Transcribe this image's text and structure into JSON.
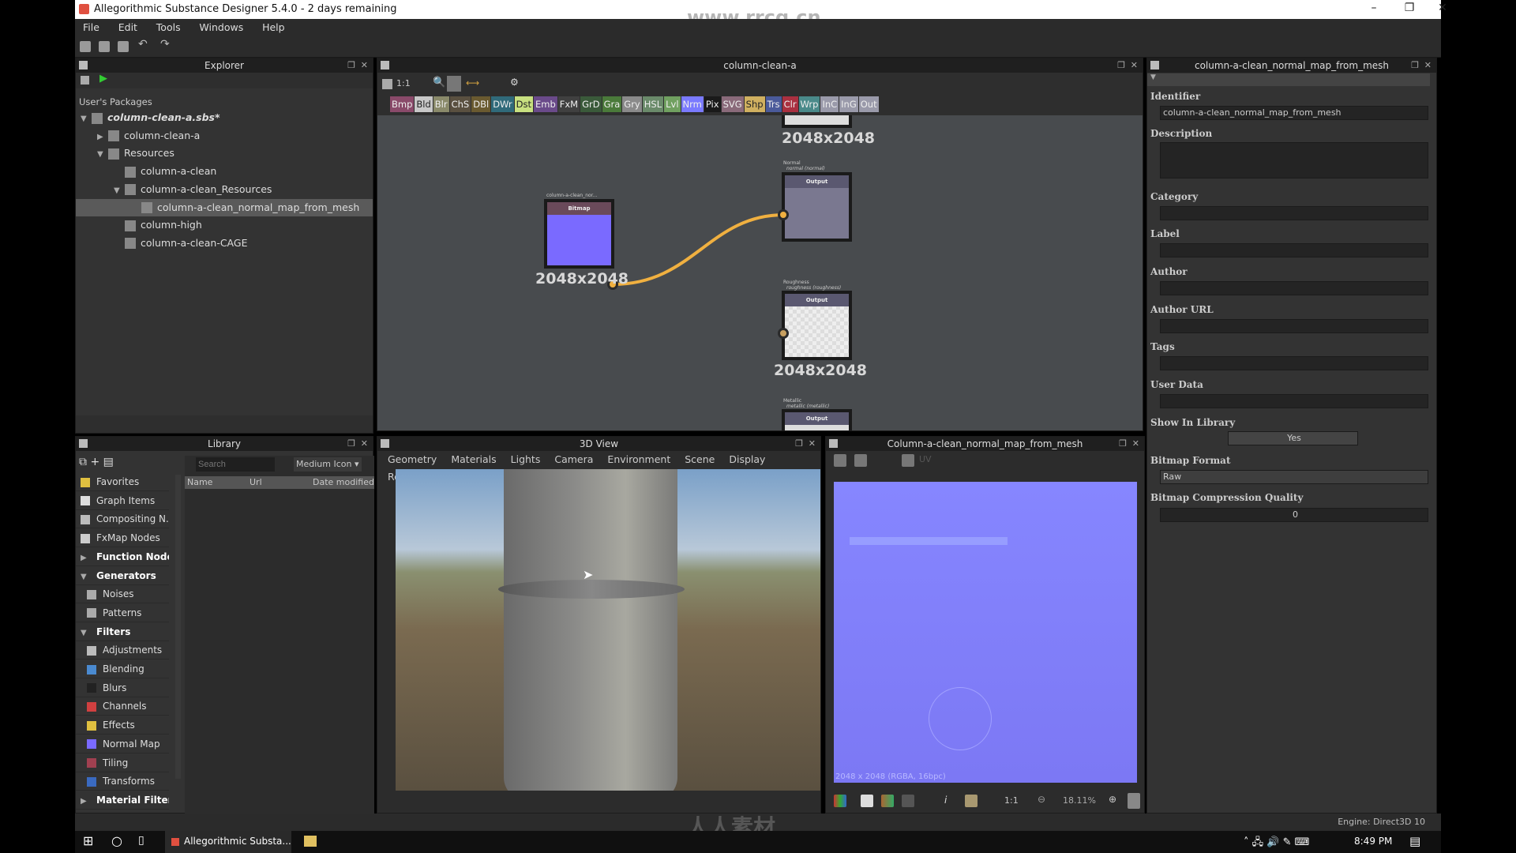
{
  "window": {
    "title": "Allegorithmic Substance Designer 5.4.0 - 2 days remaining",
    "minimize": "–",
    "maximize": "❐",
    "close": "✕"
  },
  "watermark": "www.rrcg.cn",
  "watermark_bottom": "人人素材",
  "menu": [
    "File",
    "Edit",
    "Tools",
    "Windows",
    "Help"
  ],
  "explorer": {
    "title": "Explorer",
    "section": "User's Packages",
    "items": [
      {
        "label": "column-clean-a.sbs*",
        "depth": 0,
        "arrow": "▼",
        "icon": "package-icon",
        "bold": true
      },
      {
        "label": "column-clean-a",
        "depth": 1,
        "arrow": "▶",
        "icon": "graph-icon"
      },
      {
        "label": "Resources",
        "depth": 1,
        "arrow": "▼",
        "icon": "folder-icon"
      },
      {
        "label": "column-a-clean",
        "depth": 2,
        "arrow": "",
        "icon": "mesh-icon"
      },
      {
        "label": "column-a-clean_Resources",
        "depth": 2,
        "arrow": "▼",
        "icon": "folder-icon"
      },
      {
        "label": "column-a-clean_normal_map_from_mesh",
        "depth": 3,
        "arrow": "",
        "icon": "bitmap-icon",
        "selected": true
      },
      {
        "label": "column-high",
        "depth": 2,
        "arrow": "",
        "icon": "mesh-icon"
      },
      {
        "label": "column-a-clean-CAGE",
        "depth": 2,
        "arrow": "",
        "icon": "mesh-icon"
      }
    ]
  },
  "graph": {
    "title": "column-clean-a",
    "zoom_label": "1:1",
    "node_tags": [
      {
        "label": "Bmp",
        "color": "#8a4a6a"
      },
      {
        "label": "Bld",
        "color": "#c8c8c8",
        "dark": true
      },
      {
        "label": "Blr",
        "color": "#8a8a6a"
      },
      {
        "label": "ChS",
        "color": "#5a5040"
      },
      {
        "label": "DBl",
        "color": "#6a5a30"
      },
      {
        "label": "DWr",
        "color": "#306a7a"
      },
      {
        "label": "Dst",
        "color": "#c8e080",
        "dark": true
      },
      {
        "label": "Emb",
        "color": "#6a4a8a"
      },
      {
        "label": "FxM",
        "color": "#404040"
      },
      {
        "label": "GrD",
        "color": "#3a5a3a"
      },
      {
        "label": "Gra",
        "color": "#4a7a3a"
      },
      {
        "label": "Gry",
        "color": "#8a8a8a"
      },
      {
        "label": "HSL",
        "color": "#6a8a6a"
      },
      {
        "label": "Lvl",
        "color": "#70a060"
      },
      {
        "label": "Nrm",
        "color": "#7a7aff"
      },
      {
        "label": "Pix",
        "color": "#1a1a1a"
      },
      {
        "label": "SVG",
        "color": "#8a6a7a"
      },
      {
        "label": "Shp",
        "color": "#d0b060",
        "dark": true
      },
      {
        "label": "Trs",
        "color": "#4a5a9a"
      },
      {
        "label": "Clr",
        "color": "#aa3040"
      },
      {
        "label": "Wrp",
        "color": "#4a8a8a"
      },
      {
        "label": "InC",
        "color": "#9a9aaa"
      },
      {
        "label": "InG",
        "color": "#9a9aaa"
      },
      {
        "label": "Out",
        "color": "#9a9aaa"
      }
    ],
    "nodes": {
      "top_size": "2048x2048",
      "bitmap": {
        "caption": "column-a-clean_nor...",
        "header": "Bitmap",
        "size": "2048x2048"
      },
      "normal": {
        "caption": "Normal",
        "sub": "normal (normal)",
        "header": "Output"
      },
      "roughness": {
        "caption": "Roughness",
        "sub": "roughness (roughness)",
        "header": "Output",
        "size": "2048x2048"
      },
      "metallic": {
        "caption": "Metallic",
        "sub": "metallic (metallic)",
        "header": "Output"
      }
    },
    "wire_color": "#f0b040"
  },
  "properties": {
    "title": "column-a-clean_normal_map_from_mesh",
    "fields": {
      "identifier": {
        "label": "Identifier",
        "value": "column-a-clean_normal_map_from_mesh"
      },
      "description": {
        "label": "Description",
        "value": ""
      },
      "category": {
        "label": "Category",
        "value": ""
      },
      "label": {
        "label": "Label",
        "value": ""
      },
      "author": {
        "label": "Author",
        "value": ""
      },
      "author_url": {
        "label": "Author URL",
        "value": ""
      },
      "tags": {
        "label": "Tags",
        "value": ""
      },
      "user_data": {
        "label": "User Data",
        "value": ""
      },
      "show_in_library": {
        "label": "Show In Library",
        "value": "Yes"
      },
      "bitmap_format": {
        "label": "Bitmap Format",
        "value": "Raw"
      },
      "compression": {
        "label": "Bitmap Compression Quality",
        "value": "0"
      }
    }
  },
  "library": {
    "title": "Library",
    "search_placeholder": "Search",
    "view_mode": "Medium Icon",
    "columns": [
      "Name",
      "Url",
      "Date modified"
    ],
    "items": [
      {
        "label": "Favorites",
        "icon": "star-icon",
        "color": "#e0c040"
      },
      {
        "label": "Graph Items",
        "icon": "comment-icon",
        "color": "#ddd"
      },
      {
        "label": "Compositing N...",
        "icon": "share-icon",
        "color": "#bbb"
      },
      {
        "label": "FxMap Nodes",
        "icon": "fxmap-icon",
        "color": "#ccc"
      },
      {
        "label": "Function Nodes",
        "arrow": "▶",
        "bold": true
      },
      {
        "label": "Generators",
        "arrow": "▼",
        "bold": true
      },
      {
        "label": "Noises",
        "icon": "noise-icon",
        "color": "#aaa",
        "indent": true
      },
      {
        "label": "Patterns",
        "icon": "pattern-icon",
        "color": "#aaa",
        "indent": true
      },
      {
        "label": "Filters",
        "arrow": "▼",
        "bold": true
      },
      {
        "label": "Adjustments",
        "icon": "adjust-icon",
        "color": "#bbb",
        "indent": true
      },
      {
        "label": "Blending",
        "icon": "blend-icon",
        "color": "#4a8ad0",
        "indent": true
      },
      {
        "label": "Blurs",
        "icon": "blur-icon",
        "color": "#222",
        "indent": true
      },
      {
        "label": "Channels",
        "icon": "channels-icon",
        "color": "#d04040",
        "indent": true
      },
      {
        "label": "Effects",
        "icon": "effects-icon",
        "color": "#e0c040",
        "indent": true
      },
      {
        "label": "Normal Map",
        "icon": "normal-map-icon",
        "color": "#7a6aff",
        "indent": true
      },
      {
        "label": "Tiling",
        "icon": "tiling-icon",
        "color": "#a04050",
        "indent": true
      },
      {
        "label": "Transforms",
        "icon": "transform-icon",
        "color": "#3a6ac0",
        "indent": true
      },
      {
        "label": "Material Filters",
        "arrow": "▶",
        "bold": true
      }
    ]
  },
  "view3d": {
    "title": "3D View",
    "menu": [
      "Geometry",
      "Materials",
      "Lights",
      "Camera",
      "Environment",
      "Scene",
      "Display",
      "Renderer"
    ]
  },
  "view2d": {
    "title": "Column-a-clean_normal_map_from_mesh",
    "uv_label": "UV",
    "info": "2048 x 2048 (RGBA, 16bpc)",
    "ratio": "1:1",
    "zoom": "18.11%"
  },
  "status": {
    "engine": "Engine: Direct3D 10"
  },
  "taskbar": {
    "app": "Allegorithmic Substa...",
    "time": "8:49 PM"
  }
}
